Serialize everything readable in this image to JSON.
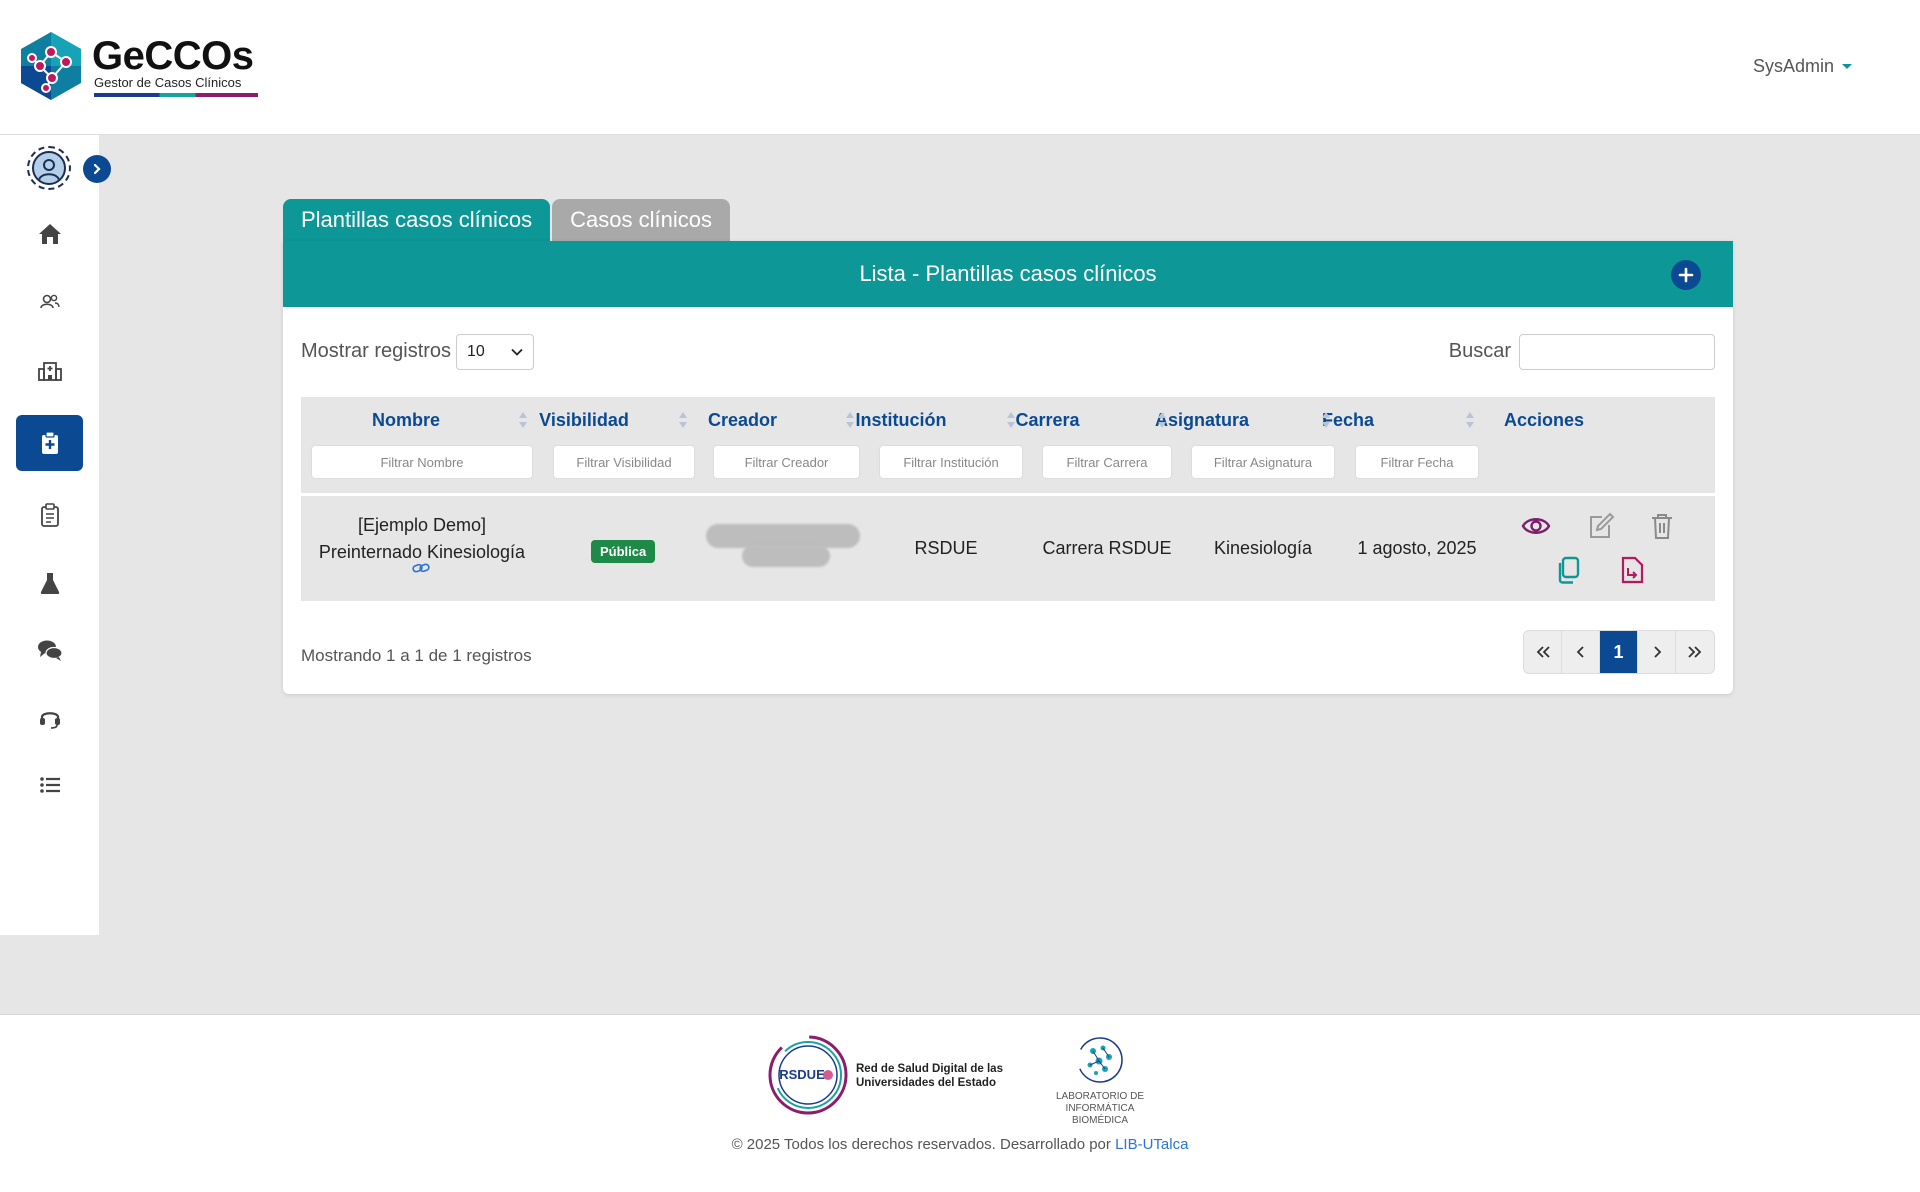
{
  "app": {
    "logo_title": "GeCCOs",
    "logo_subtitle": "Gestor de Casos Clínicos",
    "user_menu": "SysAdmin"
  },
  "sidebar": {
    "items": [
      {
        "icon": "home-icon"
      },
      {
        "icon": "users-icon"
      },
      {
        "icon": "hospital-icon"
      },
      {
        "icon": "clipboard-plus-icon",
        "active": true
      },
      {
        "icon": "clipboard-list-icon"
      },
      {
        "icon": "flask-icon"
      },
      {
        "icon": "chat-icon"
      },
      {
        "icon": "headset-icon"
      },
      {
        "icon": "list-icon"
      }
    ]
  },
  "tabs": [
    {
      "label": "Plantillas casos clínicos",
      "active": true
    },
    {
      "label": "Casos clínicos",
      "active": false
    }
  ],
  "card": {
    "title": "Lista - Plantillas casos clínicos"
  },
  "controls": {
    "show_label": "Mostrar registros",
    "page_size": "10",
    "search_label": "Buscar",
    "search_value": ""
  },
  "table": {
    "columns": [
      {
        "label": "Nombre",
        "filter": "Filtrar Nombre"
      },
      {
        "label": "Visibilidad",
        "filter": "Filtrar Visibilidad"
      },
      {
        "label": "Creador",
        "filter": "Filtrar Creador"
      },
      {
        "label": "Institución",
        "filter": "Filtrar Institución"
      },
      {
        "label": "Carrera",
        "filter": "Filtrar Carrera"
      },
      {
        "label": "Asignatura",
        "filter": "Filtrar Asignatura"
      },
      {
        "label": "Fecha",
        "filter": "Filtrar Fecha"
      },
      {
        "label": "Acciones",
        "filter": ""
      }
    ],
    "rows": [
      {
        "nombre_line1": "[Ejemplo Demo]",
        "nombre_line2": "Preinternado Kinesiología",
        "visibilidad": "Pública",
        "institucion": "RSDUE",
        "carrera": "Carrera RSDUE",
        "asignatura": "Kinesiología",
        "fecha": "1 agosto, 2025"
      }
    ]
  },
  "pagination": {
    "info": "Mostrando 1 a 1 de 1 registros",
    "current_page": "1"
  },
  "footer": {
    "rsdue_badge": "RSDUE",
    "rsdue_line1": "Red de Salud Digital de las",
    "rsdue_line2": "Universidades del Estado",
    "lib_line1": "LABORATORIO DE",
    "lib_line2": "INFORMÁTICA BIOMÉDICA",
    "copyright": "© 2025 Todos los derechos reservados. Desarrollado por",
    "dev_link": "LIB-UTalca"
  },
  "colors": {
    "teal": "#0d9797",
    "navy": "#0b4a93",
    "badge_green": "#1e8a47",
    "purple": "#7a1f6a"
  }
}
